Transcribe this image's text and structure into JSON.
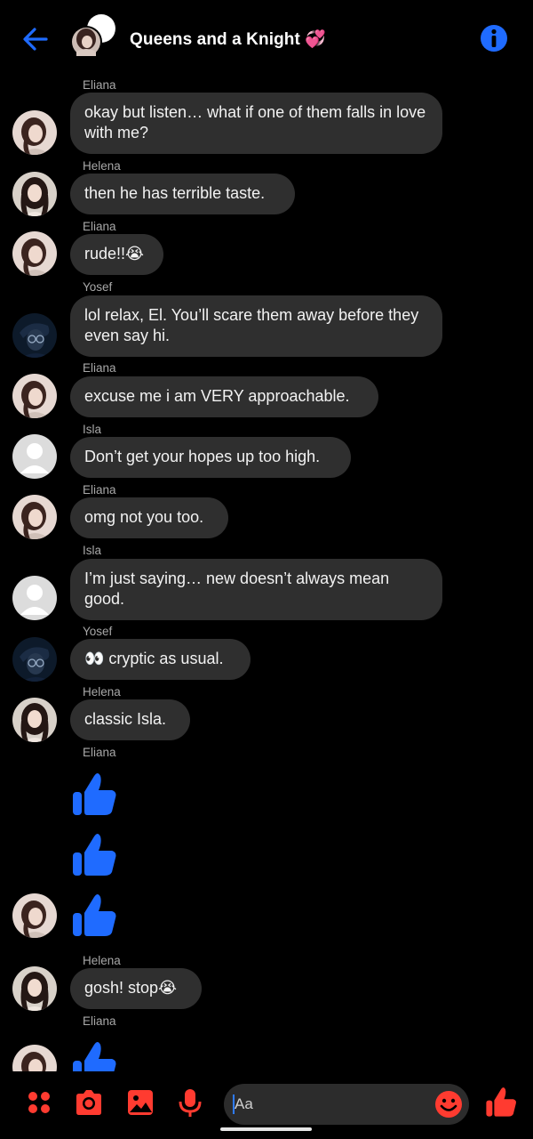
{
  "header": {
    "title": "Queens and a Knight",
    "title_emoji": "💞",
    "back_icon": "arrow-left-icon",
    "info_icon": "info-icon"
  },
  "messages": [
    {
      "sender": "Eliana",
      "text": "okay but listen… what if one of them falls in love with me?",
      "avatar": "eliana"
    },
    {
      "sender": "Helena",
      "text": "then he has terrible taste.",
      "avatar": "helena"
    },
    {
      "sender": "Eliana",
      "text": "rude!!😭",
      "avatar": "eliana"
    },
    {
      "sender": "Yosef",
      "text": "lol relax, El. You’ll scare them away before they even say hi.",
      "avatar": "yosef"
    },
    {
      "sender": "Eliana",
      "text": "excuse me i am VERY approachable.",
      "avatar": "eliana"
    },
    {
      "sender": "Isla",
      "text": "Don’t get your hopes up too high.",
      "avatar": "isla"
    },
    {
      "sender": "Eliana",
      "text": "omg not you too.",
      "avatar": "eliana"
    },
    {
      "sender": "Isla",
      "text": "I’m just saying… new doesn’t always mean good.",
      "avatar": "isla"
    },
    {
      "sender": "Yosef",
      "text": "👀 cryptic as usual.",
      "avatar": "yosef"
    },
    {
      "sender": "Helena",
      "text": "classic Isla.",
      "avatar": "helena"
    },
    {
      "sender": "Eliana",
      "likes": 3,
      "avatar": "eliana"
    },
    {
      "sender": "Helena",
      "text": "gosh! stop😭",
      "avatar": "helena"
    },
    {
      "sender": "Eliana",
      "likes": 1,
      "avatar": "eliana"
    }
  ],
  "composer": {
    "placeholder": "Aa",
    "icons": [
      "apps-icon",
      "camera-icon",
      "gallery-icon",
      "microphone-icon",
      "emoji-icon",
      "like-icon"
    ]
  },
  "colors": {
    "background": "#000000",
    "bubble": "#2f2f2f",
    "accent_blue": "#1f6bff",
    "accent_red": "#ff3b30"
  }
}
